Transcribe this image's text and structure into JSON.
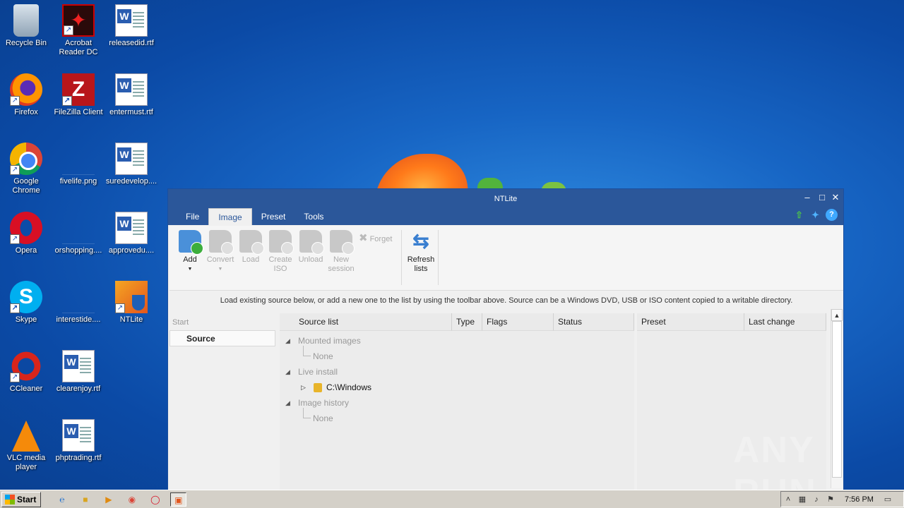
{
  "desktop": {
    "icons": [
      {
        "label": "Recycle Bin"
      },
      {
        "label": "Acrobat Reader DC"
      },
      {
        "label": "releasedid.rtf"
      },
      {
        "label": "Firefox"
      },
      {
        "label": "FileZilla Client"
      },
      {
        "label": "entermust.rtf"
      },
      {
        "label": "Google Chrome"
      },
      {
        "label": "fivelife.png"
      },
      {
        "label": "suredevelop...."
      },
      {
        "label": "Opera"
      },
      {
        "label": "orshopping...."
      },
      {
        "label": "approvedu...."
      },
      {
        "label": "Skype"
      },
      {
        "label": "interestide...."
      },
      {
        "label": "NTLite"
      },
      {
        "label": "CCleaner"
      },
      {
        "label": "clearenjoy.rtf"
      },
      {
        "label": "VLC media player"
      },
      {
        "label": "phptrading.rtf"
      }
    ]
  },
  "window": {
    "title": "NTLite",
    "controls": {
      "minimize": "–",
      "maximize": "□",
      "close": "✕"
    },
    "menu_tabs": [
      {
        "label": "File"
      },
      {
        "label": "Image"
      },
      {
        "label": "Preset"
      },
      {
        "label": "Tools"
      }
    ],
    "active_tab": "Image",
    "ribbon": {
      "add": "Add",
      "convert": "Convert",
      "load": "Load",
      "create_iso": "Create ISO",
      "unload": "Unload",
      "new_session": "New session",
      "forget": "Forget",
      "refresh_lists": "Refresh lists"
    },
    "info_text": "Load existing source below, or add a new one to the list by using the toolbar above. Source can be a Windows DVD, USB or ISO content copied to a writable directory.",
    "sidebar": {
      "heading": "Start",
      "items": [
        {
          "label": "Source"
        }
      ]
    },
    "source_table": {
      "columns": [
        "Source list",
        "Type",
        "Flags",
        "Status"
      ],
      "groups": [
        {
          "label": "Mounted images",
          "children": [
            "None"
          ]
        },
        {
          "label": "Live install",
          "children": [
            "C:\\Windows"
          ]
        },
        {
          "label": "Image history",
          "children": [
            "None"
          ]
        }
      ]
    },
    "preset_table": {
      "columns": [
        "Preset",
        "Last change"
      ]
    }
  },
  "watermark": "ANY RUN",
  "taskbar": {
    "start_label": "Start",
    "clock": "7:56 PM"
  },
  "colors": {
    "title_bar": "#2b579a",
    "desktop": "#1765c4",
    "taskbar": "#d4d0c8"
  }
}
